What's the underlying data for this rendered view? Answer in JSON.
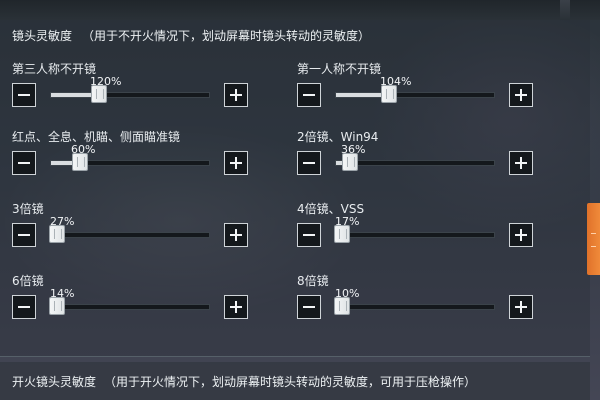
{
  "header": {
    "title": "镜头灵敏度",
    "subtitle": "（用于不开火情况下，划动屏幕时镜头转动的灵敏度）"
  },
  "sliders": [
    {
      "label": "第三人称不开镜",
      "value_text": "120%",
      "level": 0.3
    },
    {
      "label": "第一人称不开镜",
      "value_text": "104%",
      "level": 0.33
    },
    {
      "label": "红点、全息、机瞄、侧面瞄准镜",
      "value_text": "60%",
      "level": 0.18
    },
    {
      "label": "2倍镜、Win94",
      "value_text": "36%",
      "level": 0.09
    },
    {
      "label": "3倍镜",
      "value_text": "27%",
      "level": 0.02
    },
    {
      "label": "4倍镜、VSS",
      "value_text": "17%",
      "level": 0.02
    },
    {
      "label": "6倍镜",
      "value_text": "14%",
      "level": 0.01
    },
    {
      "label": "8倍镜",
      "value_text": "10%",
      "level": 0.01
    }
  ],
  "footer": {
    "title": "开火镜头灵敏度",
    "subtitle": "（用于开火情况下，划动屏幕时镜头转动的灵敏度，可用于压枪操作）"
  },
  "icons": {
    "decrease": "minus-icon",
    "increase": "plus-icon"
  },
  "colors": {
    "accent": "#f08a3a",
    "button_bg": "#14181c",
    "track_fill": "#d9dde0"
  }
}
